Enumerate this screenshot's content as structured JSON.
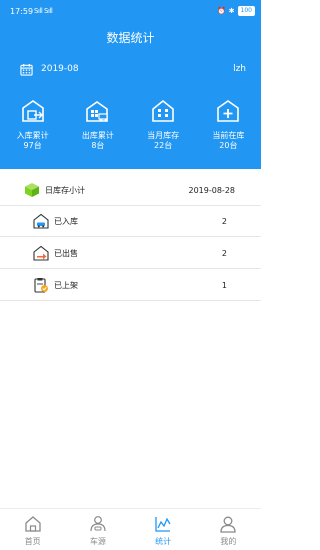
{
  "status_bar": {
    "time": "17:59",
    "signal": "Sıll Sıll",
    "battery": "100"
  },
  "header": {
    "title": "数据统计",
    "date": "2019-08",
    "user": "lzh"
  },
  "stats": [
    {
      "label": "入库累计",
      "value": "97台",
      "icon": "warehouse-in-icon"
    },
    {
      "label": "出库累计",
      "value": "8台",
      "icon": "warehouse-truck-icon"
    },
    {
      "label": "当月库存",
      "value": "22台",
      "icon": "building-icon"
    },
    {
      "label": "当前在库",
      "value": "20台",
      "icon": "house-plus-icon"
    }
  ],
  "summary": {
    "label": "日库存小计",
    "date": "2019-08-28",
    "icon": "box-icon"
  },
  "details": [
    {
      "label": "已入库",
      "value": "2",
      "icon": "house-car-icon"
    },
    {
      "label": "已出售",
      "value": "2",
      "icon": "house-arrow-icon"
    },
    {
      "label": "已上架",
      "value": "1",
      "icon": "clipboard-check-icon"
    }
  ],
  "tabs": [
    {
      "label": "首页",
      "icon": "home-icon"
    },
    {
      "label": "车源",
      "icon": "car-source-icon"
    },
    {
      "label": "统计",
      "icon": "chart-icon"
    },
    {
      "label": "我的",
      "icon": "user-icon"
    }
  ],
  "colors": {
    "primary": "#2196f3",
    "text": "#222222",
    "tab_inactive": "#8a8a8a",
    "green": "#7ed321",
    "orange": "#f5a623"
  }
}
